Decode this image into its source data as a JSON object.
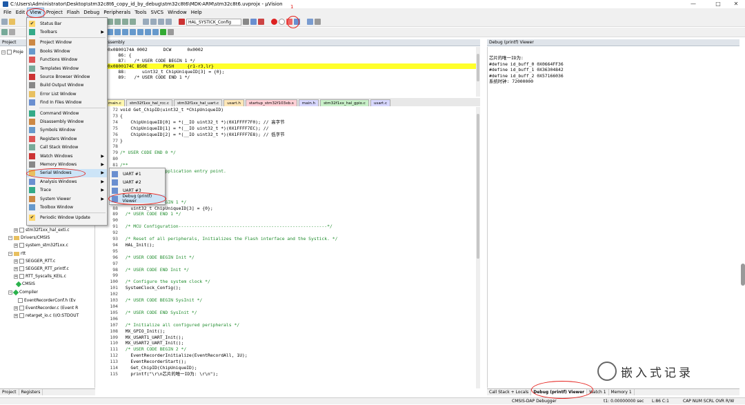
{
  "window": {
    "title": "C:\\Users\\Administrator\\Desktop\\stm32c8t6_copy_id_by_debug\\stm32c8t6\\MDK-ARM\\stm32c8t6.uvprojx - µVision",
    "controls": [
      "—",
      "□",
      "✕"
    ]
  },
  "menubar": [
    "File",
    "Edit",
    "View",
    "Project",
    "Flash",
    "Debug",
    "Peripherals",
    "Tools",
    "SVCS",
    "Window",
    "Help"
  ],
  "toolbar": {
    "target_combo": "HAL_SYSTICK_Config",
    "annotation_number": "1"
  },
  "project_pane": {
    "title": "Project",
    "tree": [
      {
        "label": "Proje",
        "kind": "root"
      },
      {
        "label": "stm32f1xx_hal_exti.c",
        "kind": "file"
      },
      {
        "label": "Drivers/CMSIS",
        "kind": "folder"
      },
      {
        "label": "system_stm32f1xx.c",
        "kind": "file"
      },
      {
        "label": "rtt",
        "kind": "folder"
      },
      {
        "label": "SEGGER_RTT.c",
        "kind": "file"
      },
      {
        "label": "SEGGER_RTT_printf.c",
        "kind": "file"
      },
      {
        "label": "RTT_Syscalls_KEIL.c",
        "kind": "file"
      },
      {
        "label": "CMSIS",
        "kind": "gem"
      },
      {
        "label": "Compiler",
        "kind": "gem"
      },
      {
        "label": "EventRecorderConf.h (Ev",
        "kind": "file"
      },
      {
        "label": "EventRecorder.c (Event R",
        "kind": "file"
      },
      {
        "label": "retarget_io.c (I/O:STDOUT",
        "kind": "file"
      }
    ],
    "bottom_tabs": [
      "Project",
      "Registers"
    ]
  },
  "view_menu": {
    "items": [
      {
        "label": "Status Bar",
        "check": true
      },
      {
        "label": "Toolbars",
        "submenu": true
      },
      {
        "label": "Project Window",
        "sep_before": true
      },
      {
        "label": "Books Window"
      },
      {
        "label": "Functions Window"
      },
      {
        "label": "Templates Window"
      },
      {
        "label": "Source Browser Window"
      },
      {
        "label": "Build Output Window"
      },
      {
        "label": "Error List Window"
      },
      {
        "label": "Find In Files Window"
      },
      {
        "label": "Command Window",
        "sep_before": true
      },
      {
        "label": "Disassembly Window"
      },
      {
        "label": "Symbols Window"
      },
      {
        "label": "Registers Window"
      },
      {
        "label": "Call Stack Window"
      },
      {
        "label": "Watch Windows",
        "submenu": true
      },
      {
        "label": "Memory Windows",
        "submenu": true
      },
      {
        "label": "Serial Windows",
        "submenu": true,
        "highlight": true
      },
      {
        "label": "Analysis Windows",
        "submenu": true
      },
      {
        "label": "Trace",
        "submenu": true
      },
      {
        "label": "System Viewer",
        "submenu": true
      },
      {
        "label": "Toolbox Window"
      },
      {
        "label": "Periodic Window Update",
        "check": true,
        "sep_before": true
      }
    ]
  },
  "serial_submenu": [
    "UART #1",
    "UART #2",
    "UART #3",
    "Debug (printf) Viewer"
  ],
  "disassembly": {
    "title": "Disassembly",
    "lines": [
      {
        "text": "0x0800174A 0002      DCW      0x0002",
        "hl": false
      },
      {
        "text": "    86: {",
        "hl": false
      },
      {
        "text": "    87:   /* USER CODE BEGIN 1 */",
        "hl": false
      },
      {
        "text": "0x0800174C B50E      PUSH     {r1-r3,lr}",
        "hl": true
      },
      {
        "text": "    88:      uint32_t ChipUniqueID[3] = {0};",
        "hl": false
      },
      {
        "text": "    89:   /* USER CODE END 1 */",
        "hl": false
      }
    ]
  },
  "editor_tabs": [
    {
      "label": "main.c",
      "color": "#fff7b0"
    },
    {
      "label": "stm32f1xx_hal_rcc.c",
      "color": "#e8e8e8"
    },
    {
      "label": "stm32f1xx_hal_uart.c",
      "color": "#e8e8e8"
    },
    {
      "label": "usart.h",
      "color": "#ffe7b8"
    },
    {
      "label": "startup_stm32f103xb.s",
      "color": "#ffd0d6"
    },
    {
      "label": "main.h",
      "color": "#d8d8ff"
    },
    {
      "label": "stm32f1xx_hal_gpio.c",
      "color": "#c8f0c8"
    },
    {
      "label": "usart.c",
      "color": "#d8d8ff"
    }
  ],
  "code_lines": [
    {
      "n": "72",
      "t": "void Get_ChipID(uint32_t *ChipUniqueID)"
    },
    {
      "n": "73",
      "t": "{"
    },
    {
      "n": "74",
      "t": "    ChipUniqueID[0] = *(__IO uint32_t *)(0X1FFFF7F0); // 高字节"
    },
    {
      "n": "75",
      "t": "    ChipUniqueID[1] = *(__IO uint32_t *)(0X1FFFF7EC); //"
    },
    {
      "n": "76",
      "t": "    ChipUniqueID[2] = *(__IO uint32_t *)(0X1FFFF7E8); // 低字节"
    },
    {
      "n": "77",
      "t": "}"
    },
    {
      "n": "78",
      "t": ""
    },
    {
      "n": "79",
      "t": "/* USER CODE END 0 */"
    },
    {
      "n": "80",
      "t": ""
    },
    {
      "n": "81",
      "t": "/**"
    },
    {
      "n": "82",
      "t": "  * @brief  The application entry point."
    },
    {
      "n": "83",
      "t": "  * @retval int"
    },
    {
      "n": "84",
      "t": "  */"
    },
    {
      "n": "85",
      "t": "int main(void)"
    },
    {
      "n": "86",
      "t": "{"
    },
    {
      "n": "87",
      "t": "  /* USER CODE BEGIN 1 */"
    },
    {
      "n": "88",
      "t": "    uint32_t ChipUniqueID[3] = {0};"
    },
    {
      "n": "89",
      "t": "  /* USER CODE END 1 */"
    },
    {
      "n": "90",
      "t": ""
    },
    {
      "n": "91",
      "t": "  /* MCU Configuration--------------------------------------------------------*/"
    },
    {
      "n": "92",
      "t": ""
    },
    {
      "n": "93",
      "t": "  /* Reset of all peripherals, Initializes the Flash interface and the Systick. */"
    },
    {
      "n": "94",
      "t": "  HAL_Init();"
    },
    {
      "n": "95",
      "t": ""
    },
    {
      "n": "96",
      "t": "  /* USER CODE BEGIN Init */"
    },
    {
      "n": "97",
      "t": ""
    },
    {
      "n": "98",
      "t": "  /* USER CODE END Init */"
    },
    {
      "n": "99",
      "t": ""
    },
    {
      "n": "100",
      "t": "  /* Configure the system clock */"
    },
    {
      "n": "101",
      "t": "  SystemClock_Config();"
    },
    {
      "n": "102",
      "t": ""
    },
    {
      "n": "103",
      "t": "  /* USER CODE BEGIN SysInit */"
    },
    {
      "n": "104",
      "t": ""
    },
    {
      "n": "105",
      "t": "  /* USER CODE END SysInit */"
    },
    {
      "n": "106",
      "t": ""
    },
    {
      "n": "107",
      "t": "  /* Initialize all configured peripherals */"
    },
    {
      "n": "108",
      "t": "  MX_GPIO_Init();"
    },
    {
      "n": "109",
      "t": "  MX_USART1_UART_Init();"
    },
    {
      "n": "110",
      "t": "  MX_USART2_UART_Init();"
    },
    {
      "n": "111",
      "t": "  /* USER CODE BEGIN 2 */"
    },
    {
      "n": "112",
      "t": "    EventRecorderInitialize(EventRecordAll, 1U);"
    },
    {
      "n": "113",
      "t": "    EventRecorderStart();"
    },
    {
      "n": "114",
      "t": "    Get_ChipID(ChipUniqueID);"
    },
    {
      "n": "115",
      "t": "    printf(\"\\r\\n芯片的唯一ID为: \\r\\n\");"
    }
  ],
  "debug_viewer": {
    "title": "Debug (printf) Viewer",
    "lines": [
      "芯片的唯一ID为:",
      "#define id_buff_0 0X0664FF36",
      "#define id_buff_1 0X36304842",
      "#define id_buff_2 0X57166036",
      "系统时钟: 72000000"
    ],
    "bottom_tabs": [
      "Call Stack + Locals",
      "Debug (printf) Viewer",
      "Watch 1",
      "Memory 1"
    ]
  },
  "statusbar": {
    "debugger": "CMSIS-DAP Debugger",
    "time": "t1: 0.00000000 sec",
    "pos": "L:86 C:1",
    "flags": "CAP  NUM  SCRL  OVR  R/W"
  },
  "watermark": "嵌入式记录",
  "colors": {
    "annotation": "#e5201b",
    "highlight": "#ffff2a",
    "comment": "#1f8c2c"
  }
}
